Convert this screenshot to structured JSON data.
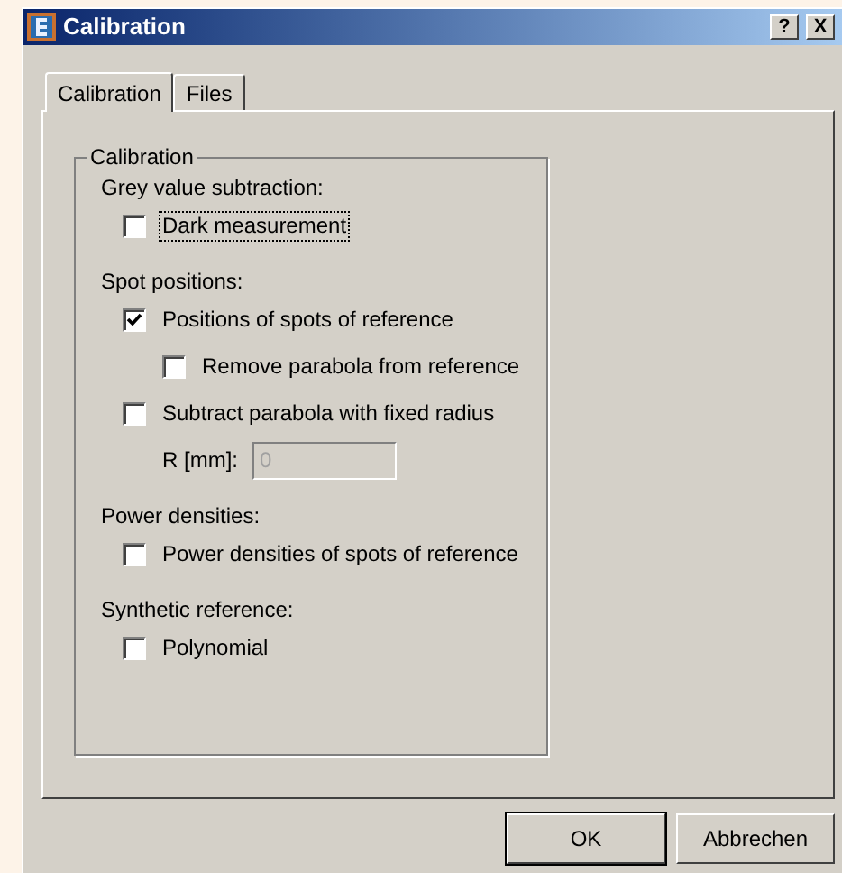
{
  "window": {
    "title": "Calibration",
    "help_button": "?",
    "close_button": "X"
  },
  "tabs": [
    {
      "label": "Calibration",
      "selected": true
    },
    {
      "label": "Files",
      "selected": false
    }
  ],
  "group": {
    "title": "Calibration",
    "sections": [
      {
        "heading": "Grey value subtraction:",
        "items": [
          {
            "kind": "checkbox",
            "label": "Dark measurement",
            "checked": false,
            "focused": true
          }
        ]
      },
      {
        "heading": "Spot positions:",
        "items": [
          {
            "kind": "checkbox",
            "label": "Positions of spots of reference",
            "checked": true,
            "focused": false,
            "children": [
              {
                "kind": "checkbox",
                "label": "Remove parabola from reference",
                "checked": false,
                "focused": false
              }
            ]
          },
          {
            "kind": "checkbox",
            "label": "Subtract parabola with fixed radius",
            "checked": false,
            "focused": false
          },
          {
            "kind": "field",
            "label": "R [mm]:",
            "value": "0",
            "disabled": true
          }
        ]
      },
      {
        "heading": "Power densities:",
        "items": [
          {
            "kind": "checkbox",
            "label": "Power densities of spots of reference",
            "checked": false,
            "focused": false
          }
        ]
      },
      {
        "heading": "Synthetic reference:",
        "items": [
          {
            "kind": "checkbox",
            "label": "Polynomial",
            "checked": false,
            "focused": false
          }
        ]
      }
    ]
  },
  "buttons": [
    {
      "label": "OK",
      "default": true
    },
    {
      "label": "Abbrechen",
      "default": false
    }
  ]
}
